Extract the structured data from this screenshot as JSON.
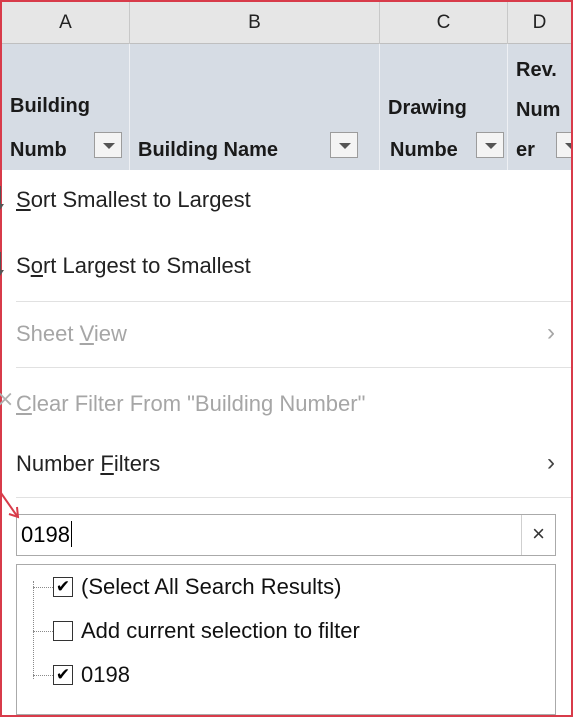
{
  "columns": {
    "letters": [
      "A",
      "B",
      "C",
      "D"
    ]
  },
  "headers": {
    "building_number": {
      "line1": "Building",
      "line2": "Numb"
    },
    "building_name": "Building Name",
    "drawing_number": {
      "line1": "Drawing",
      "line2": "Numbe"
    },
    "rev_number": {
      "line1": "Rev.",
      "line2": "Num",
      "line3": "er"
    }
  },
  "menu": {
    "sort_asc": {
      "pre": "",
      "u": "S",
      "post": "ort Smallest to Largest"
    },
    "sort_desc": {
      "pre": "S",
      "u": "o",
      "post": "rt Largest to Smallest"
    },
    "sheet_view": {
      "pre": "Sheet ",
      "u": "V",
      "post": "iew"
    },
    "clear_filter": {
      "pre": "",
      "u": "C",
      "post": "lear Filter From \"Building Number\""
    },
    "number_filters": {
      "pre": "Number ",
      "u": "F",
      "post": "ilters"
    },
    "chevron": "›",
    "clear_icon": "×"
  },
  "search": {
    "value": "0198"
  },
  "tree": {
    "items": [
      {
        "label": "(Select All Search Results)",
        "checked": true
      },
      {
        "label": "Add current selection to filter",
        "checked": false
      },
      {
        "label": "0198",
        "checked": true
      }
    ],
    "check_glyph": "✔"
  },
  "colors": {
    "annotation_red": "#d83b4a",
    "header_fill": "#d6dce4",
    "column_header_fill": "#e6e6e6"
  }
}
